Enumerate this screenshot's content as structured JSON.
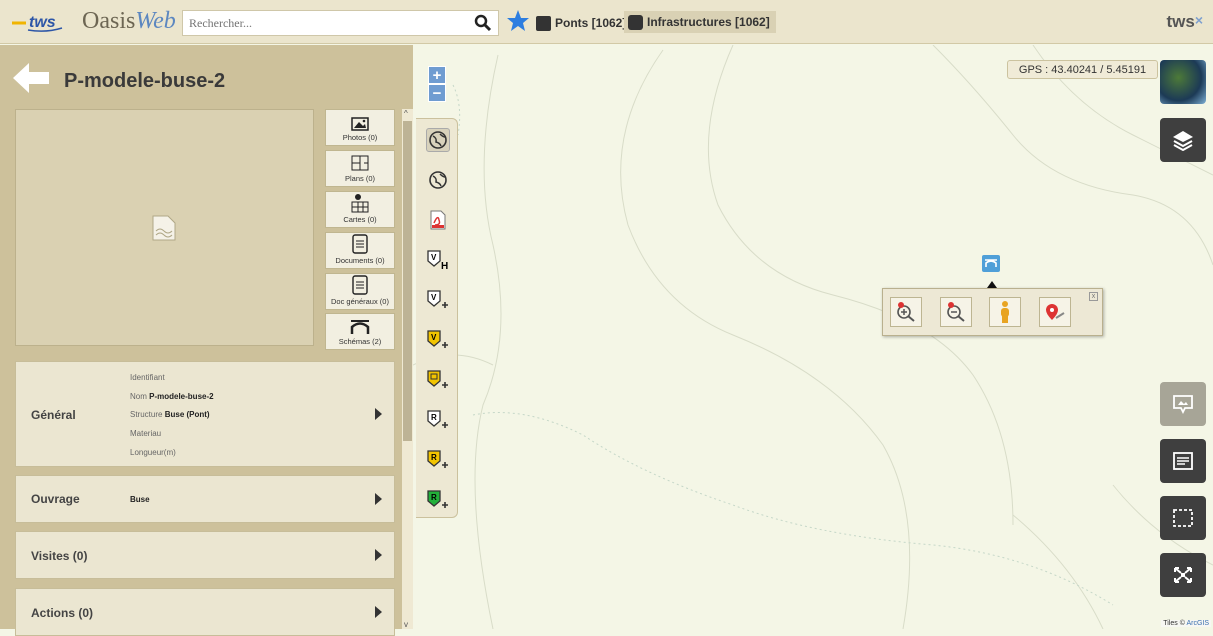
{
  "header": {
    "logo_text": "tws",
    "app_name_main": "Oasis",
    "app_name_accent": "Web",
    "search_placeholder": "Rechercher...",
    "tab_ponts": "Ponts [1062]",
    "tab_infrastructures": "Infrastructures [1062]",
    "brand": "tws",
    "brand_close": "×"
  },
  "sidebar": {
    "title": "P-modele-buse-2",
    "media_buttons": [
      {
        "label": "Photos (0)",
        "icon": "photo-icon"
      },
      {
        "label": "Plans (0)",
        "icon": "plan-icon"
      },
      {
        "label": "Cartes (0)",
        "icon": "map-icon"
      },
      {
        "label": "Documents (0)",
        "icon": "document-icon"
      },
      {
        "label": "Doc généraux (0)",
        "icon": "document-icon"
      },
      {
        "label": "Schémas (2)",
        "icon": "bridge-schema-icon"
      }
    ],
    "general": {
      "title": "Général",
      "fields": [
        {
          "label": "Identifiant",
          "value": ""
        },
        {
          "label": "Nom",
          "value": "P-modele-buse-2"
        },
        {
          "label": "Structure",
          "value": "Buse (Pont)"
        },
        {
          "label": "Materiau",
          "value": ""
        },
        {
          "label": "Longueur(m)",
          "value": ""
        }
      ]
    },
    "ouvrage": {
      "title": "Ouvrage",
      "value": "Buse"
    },
    "visites": {
      "title": "Visites (0)"
    },
    "actions": {
      "title": "Actions (0)"
    }
  },
  "map": {
    "zoom_in": "+",
    "zoom_out": "−",
    "gps": "GPS : 43.40241 / 5.45191",
    "attribution_prefix": "Tiles © ",
    "attribution_link": "ArcGIS",
    "toolbar_icons": [
      "globe-active-icon",
      "globe-icon",
      "pdf-icon",
      "visit-h-icon",
      "visit-add-icon",
      "visit-add-yellow-icon",
      "doc-add-yellow-icon",
      "report-add-icon",
      "report-add-yellow-icon",
      "report-add-green-icon"
    ],
    "popup_icons": [
      "zoom-in-marker-icon",
      "zoom-out-marker-icon",
      "streetview-icon",
      "map-pin-icon"
    ],
    "right_buttons": [
      "satellite-thumbnail",
      "layers-icon",
      "image-comment-icon",
      "list-icon",
      "selection-icon",
      "fullscreen-icon"
    ]
  }
}
